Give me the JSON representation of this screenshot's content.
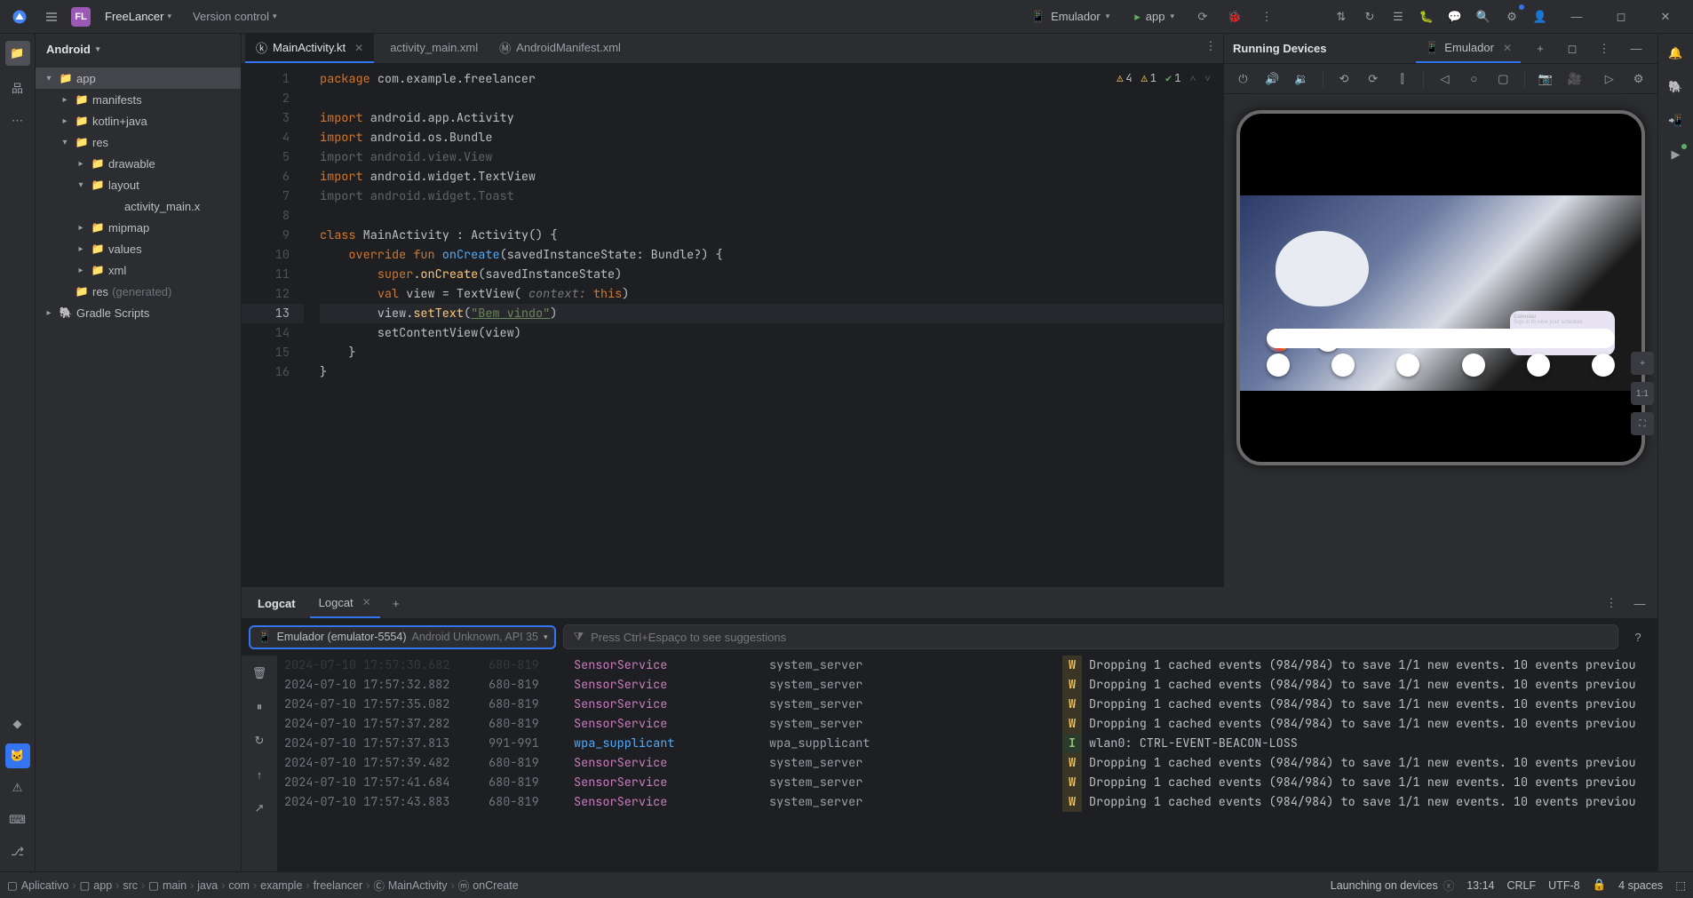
{
  "titlebar": {
    "project_badge": "FL",
    "project_name": "FreeLancer",
    "vcs_label": "Version control",
    "device_chip": "Emulador",
    "run_config": "app"
  },
  "project_panel": {
    "header": "Android",
    "items": [
      {
        "label": "app",
        "indent": 0,
        "arrow": "▾",
        "icon": "📁",
        "selected": true
      },
      {
        "label": "manifests",
        "indent": 1,
        "arrow": "▸",
        "icon": "📁"
      },
      {
        "label": "kotlin+java",
        "indent": 1,
        "arrow": "▸",
        "icon": "📁"
      },
      {
        "label": "res",
        "indent": 1,
        "arrow": "▾",
        "icon": "📁"
      },
      {
        "label": "drawable",
        "indent": 2,
        "arrow": "▸",
        "icon": "📁"
      },
      {
        "label": "layout",
        "indent": 2,
        "arrow": "▾",
        "icon": "📁"
      },
      {
        "label": "activity_main.xml",
        "indent": 3,
        "arrow": "",
        "icon": "</>",
        "truncated": "activity_main.x"
      },
      {
        "label": "mipmap",
        "indent": 2,
        "arrow": "▸",
        "icon": "📁"
      },
      {
        "label": "values",
        "indent": 2,
        "arrow": "▸",
        "icon": "📁"
      },
      {
        "label": "xml",
        "indent": 2,
        "arrow": "▸",
        "icon": "📁"
      },
      {
        "label": "res",
        "suffix": "(generated)",
        "indent": 1,
        "arrow": "",
        "icon": "📁"
      },
      {
        "label": "Gradle Scripts",
        "indent": 0,
        "arrow": "▸",
        "icon": "🐘"
      }
    ]
  },
  "editor": {
    "tabs": [
      {
        "label": "MainActivity.kt",
        "active": true,
        "closable": true,
        "icon": "ⓚ"
      },
      {
        "label": "activity_main.xml",
        "active": false,
        "closable": false,
        "icon": "</>"
      },
      {
        "label": "AndroidManifest.xml",
        "active": false,
        "closable": false,
        "icon": "Ⓜ"
      }
    ],
    "inspections": {
      "warn1": "4",
      "warn2": "1",
      "ok": "1"
    },
    "lines": [
      {
        "n": 1,
        "html": "<span class='kw'>package</span> <span class='pkg'>com.example.freelancer</span>"
      },
      {
        "n": 2,
        "html": ""
      },
      {
        "n": 3,
        "html": "<span class='kw'>import</span> <span class='pkg'>android.app.Activity</span>"
      },
      {
        "n": 4,
        "html": "<span class='kw'>import</span> <span class='pkg'>android.os.Bundle</span>"
      },
      {
        "n": 5,
        "html": "<span class='dim'>import android.view.View</span>"
      },
      {
        "n": 6,
        "html": "<span class='kw'>import</span> <span class='pkg'>android.widget.TextView</span>"
      },
      {
        "n": 7,
        "html": "<span class='dim'>import android.widget.Toast</span>"
      },
      {
        "n": 8,
        "html": ""
      },
      {
        "n": 9,
        "html": "<span class='kw'>class</span> <span class='pkg'>MainActivity</span> : <span class='pkg'>Activity</span>() {",
        "run": true
      },
      {
        "n": 10,
        "html": "    <span class='kw'>override</span> <span class='kw'>fun</span> <span class='fnblue'>onCreate</span>(savedInstanceState: Bundle?) {"
      },
      {
        "n": 11,
        "html": "        <span class='kw'>super</span>.<span class='fn'>onCreate</span>(savedInstanceState)"
      },
      {
        "n": 12,
        "html": "        <span class='kw'>val</span> view = TextView( <span class='hint'>context:</span> <span class='thiskw'>this</span>)"
      },
      {
        "n": 13,
        "html": "        view.<span class='fn'>setText</span>(<span class='str strU'>\"Bem vindo\"</span>)",
        "hl": true
      },
      {
        "n": 14,
        "html": "        setContentView(view)"
      },
      {
        "n": 15,
        "html": "    }"
      },
      {
        "n": 16,
        "html": "}"
      }
    ]
  },
  "devices": {
    "title": "Running Devices",
    "tab": "Emulador",
    "calendar_title": "Calendar",
    "calendar_body": "Sign in to view your schedule",
    "zoom_plus": "+",
    "zoom_11": "1:1"
  },
  "logcat": {
    "tool_title": "Logcat",
    "tab_label": "Logcat",
    "device_label": "Emulador (emulator-5554)",
    "device_sub": "Android Unknown, API 35",
    "filter_placeholder": "Press Ctrl+Espaço to see suggestions",
    "rows": [
      {
        "time": "2024-07-10 17:57:30.682",
        "pid": "680-819",
        "tag": "SensorService",
        "tagClass": "sensor",
        "proc": "system_server",
        "level": "W",
        "msg": "Dropping 1 cached events (984/984) to save 1/1 new events. 10 events previou",
        "cut": true
      },
      {
        "time": "2024-07-10 17:57:32.882",
        "pid": "680-819",
        "tag": "SensorService",
        "tagClass": "sensor",
        "proc": "system_server",
        "level": "W",
        "msg": "Dropping 1 cached events (984/984) to save 1/1 new events. 10 events previou"
      },
      {
        "time": "2024-07-10 17:57:35.082",
        "pid": "680-819",
        "tag": "SensorService",
        "tagClass": "sensor",
        "proc": "system_server",
        "level": "W",
        "msg": "Dropping 1 cached events (984/984) to save 1/1 new events. 10 events previou"
      },
      {
        "time": "2024-07-10 17:57:37.282",
        "pid": "680-819",
        "tag": "SensorService",
        "tagClass": "sensor",
        "proc": "system_server",
        "level": "W",
        "msg": "Dropping 1 cached events (984/984) to save 1/1 new events. 10 events previou"
      },
      {
        "time": "2024-07-10 17:57:37.813",
        "pid": "991-991",
        "tag": "wpa_supplicant",
        "tagClass": "wpa",
        "proc": "wpa_supplicant",
        "level": "I",
        "msg": "wlan0: CTRL-EVENT-BEACON-LOSS"
      },
      {
        "time": "2024-07-10 17:57:39.482",
        "pid": "680-819",
        "tag": "SensorService",
        "tagClass": "sensor",
        "proc": "system_server",
        "level": "W",
        "msg": "Dropping 1 cached events (984/984) to save 1/1 new events. 10 events previou"
      },
      {
        "time": "2024-07-10 17:57:41.684",
        "pid": "680-819",
        "tag": "SensorService",
        "tagClass": "sensor",
        "proc": "system_server",
        "level": "W",
        "msg": "Dropping 1 cached events (984/984) to save 1/1 new events. 10 events previou"
      },
      {
        "time": "2024-07-10 17:57:43.883",
        "pid": "680-819",
        "tag": "SensorService",
        "tagClass": "sensor",
        "proc": "system_server",
        "level": "W",
        "msg": "Dropping 1 cached events (984/984) to save 1/1 new events. 10 events previou"
      }
    ]
  },
  "breadcrumbs": [
    "Aplicativo",
    "app",
    "src",
    "main",
    "java",
    "com",
    "example",
    "freelancer",
    "MainActivity",
    "onCreate"
  ],
  "status": {
    "launch": "Launching on devices",
    "time": "13:14",
    "line_ending": "CRLF",
    "encoding": "UTF-8",
    "indent": "4 spaces"
  }
}
